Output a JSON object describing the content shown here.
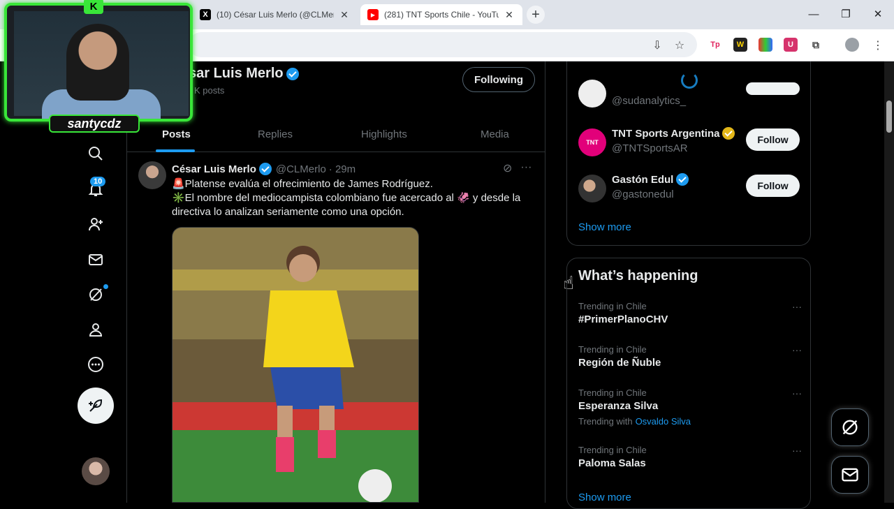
{
  "browser": {
    "tabs": [
      {
        "title": "(10) César Luis Merlo (@CLMerl",
        "favicon": "X",
        "active": false
      },
      {
        "title": "(281) TNT Sports Chile - YouTub",
        "favicon": "▶",
        "active": true
      }
    ],
    "new_tab_label": "+",
    "window_controls": {
      "minimize": "—",
      "restore": "❐",
      "close": "✕"
    }
  },
  "profile": {
    "name": "César Luis Merlo",
    "visible_name": "sar Luis Merlo",
    "posts_count": "K posts",
    "following_label": "Following"
  },
  "profile_tabs": [
    {
      "label": "Posts",
      "active": true
    },
    {
      "label": "Replies",
      "active": false
    },
    {
      "label": "Highlights",
      "active": false
    },
    {
      "label": "Media",
      "active": false
    }
  ],
  "nav": {
    "notifications_badge": "10"
  },
  "tweet": {
    "author": "César Luis Merlo",
    "handle": "@CLMerlo",
    "time": "· 29m",
    "line1": "🚨Platense evalúa el ofrecimiento de James Rodríguez.",
    "line2": "✳️El nombre del mediocampista colombiano fue acercado al 🦑 y desde la directiva lo analizan seriamente como una opción."
  },
  "who_to_follow": [
    {
      "name": "",
      "handle": "@sudanalytics_",
      "follow": ""
    },
    {
      "name": "TNT Sports Argentina",
      "handle": "@TNTSportsAR",
      "follow": "Follow",
      "verified": "gold"
    },
    {
      "name": "Gastón Edul",
      "handle": "@gastonedul",
      "follow": "Follow",
      "verified": "blue"
    }
  ],
  "show_more_1": "Show more",
  "happening": {
    "title": "What’s happening",
    "trends": [
      {
        "context": "Trending in Chile",
        "topic": "#PrimerPlanoCHV"
      },
      {
        "context": "Trending in Chile",
        "topic": "Región de Ñuble"
      },
      {
        "context": "Trending in Chile",
        "topic": "Esperanza Silva",
        "with_label": "Trending with",
        "with_value": "Osvaldo Silva"
      },
      {
        "context": "Trending in Chile",
        "topic": "Paloma Salas"
      }
    ],
    "show_more": "Show more"
  },
  "webcam": {
    "name": "santycdz",
    "logo": "K"
  },
  "colors": {
    "accent": "#1d9bf0",
    "webcam_border": "#39e639",
    "background": "#000000"
  }
}
